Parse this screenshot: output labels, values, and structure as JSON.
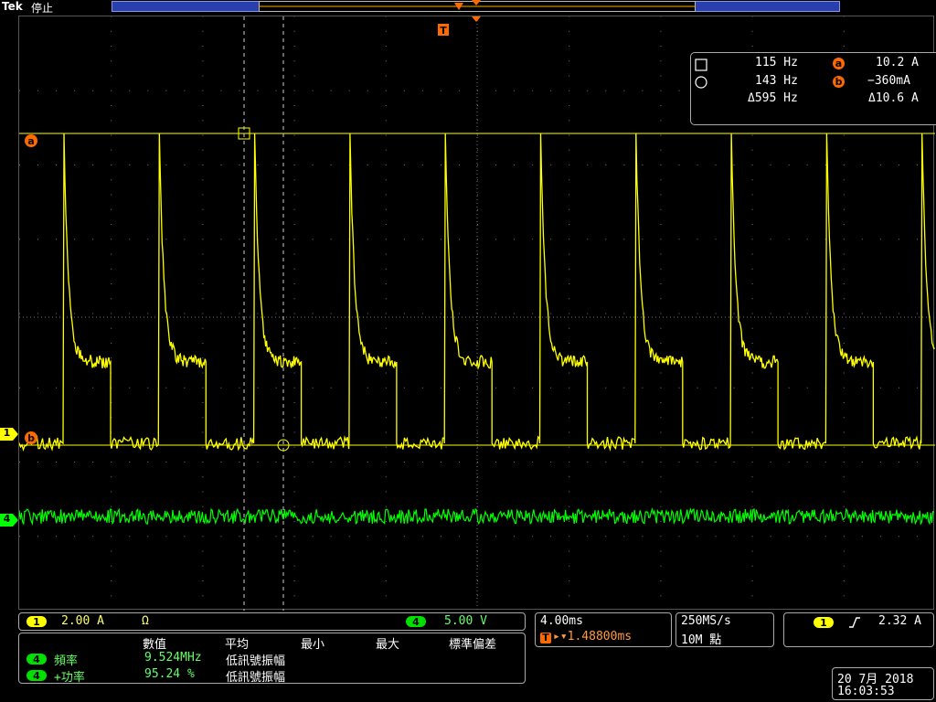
{
  "header": {
    "brand": "Tek",
    "run_state": "停止"
  },
  "colors": {
    "ch1": "#ffff00",
    "ch4": "#00ff00",
    "cursor": "#ff6a00",
    "grid": "#777777",
    "record": "#2a3fae"
  },
  "markers": {
    "trigger": "T",
    "cursor_a": "a",
    "cursor_b": "b",
    "ch1": "1",
    "ch4": "4"
  },
  "cursor_readout": {
    "square_label": "115 Hz",
    "circle_label": "143 Hz",
    "delta_freq": "Δ595 Hz",
    "a_value": "10.2 A",
    "b_value": "−360mA",
    "delta_value": "Δ10.6 A"
  },
  "channels": {
    "ch1": {
      "label": "1",
      "scale": "2.00 A",
      "coupling_icon": "Ω"
    },
    "ch4": {
      "label": "4",
      "scale": "5.00 V"
    }
  },
  "timebase": {
    "scale": "4.00ms",
    "trigger_prefix": "T",
    "trigger_pos": "▸▾1.48800ms"
  },
  "acquisition": {
    "rate": "250MS/s",
    "record": "10M 點"
  },
  "trigger": {
    "source": "1",
    "slope_icon": "rising-edge-icon",
    "level": "2.32 A"
  },
  "measurements": {
    "headers": [
      "數值",
      "平均",
      "最小",
      "最大",
      "標準偏差"
    ],
    "rows": [
      {
        "channel": "4",
        "name": "頻率",
        "value": "9.524MHz",
        "note": "低訊號振幅"
      },
      {
        "channel": "4",
        "name": "+功率",
        "value": "95.24 %",
        "note": "低訊號振幅"
      }
    ]
  },
  "datetime": {
    "date": "20 7月  2018",
    "time": "16:03:53"
  }
}
